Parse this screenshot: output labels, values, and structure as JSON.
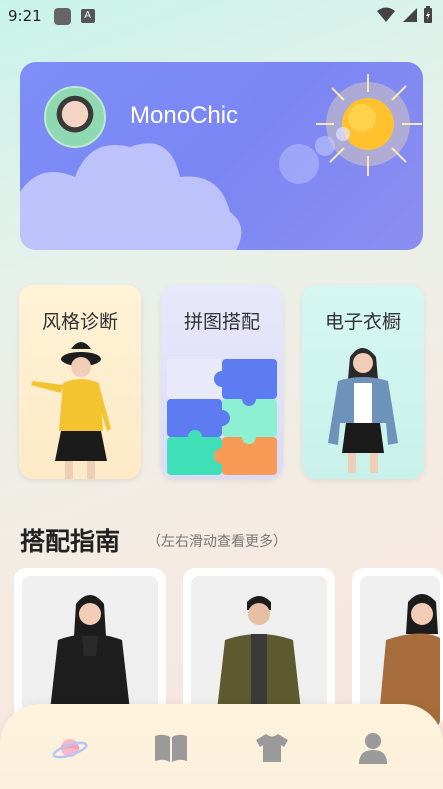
{
  "status_bar": {
    "time": "9:21",
    "app_badge": "A"
  },
  "banner": {
    "brand_name": "MonoChic"
  },
  "features": [
    {
      "label": "风格诊断",
      "icon": "fashion-model-illustration"
    },
    {
      "label": "拼图搭配",
      "icon": "puzzle-illustration"
    },
    {
      "label": "电子衣橱",
      "icon": "denim-jacket-model-illustration"
    }
  ],
  "guide": {
    "title": "搭配指南",
    "hint": "（左右滑动查看更多）"
  },
  "bottom_nav": {
    "items": [
      "planet-icon",
      "book-icon",
      "tshirt-icon",
      "user-icon"
    ]
  },
  "colors": {
    "banner": "#7f8ef9",
    "puzzle_orange": "#f79a56",
    "puzzle_blue": "#5d7cf2",
    "puzzle_mint": "#8ef0d2",
    "puzzle_green": "#3fe0b8"
  }
}
